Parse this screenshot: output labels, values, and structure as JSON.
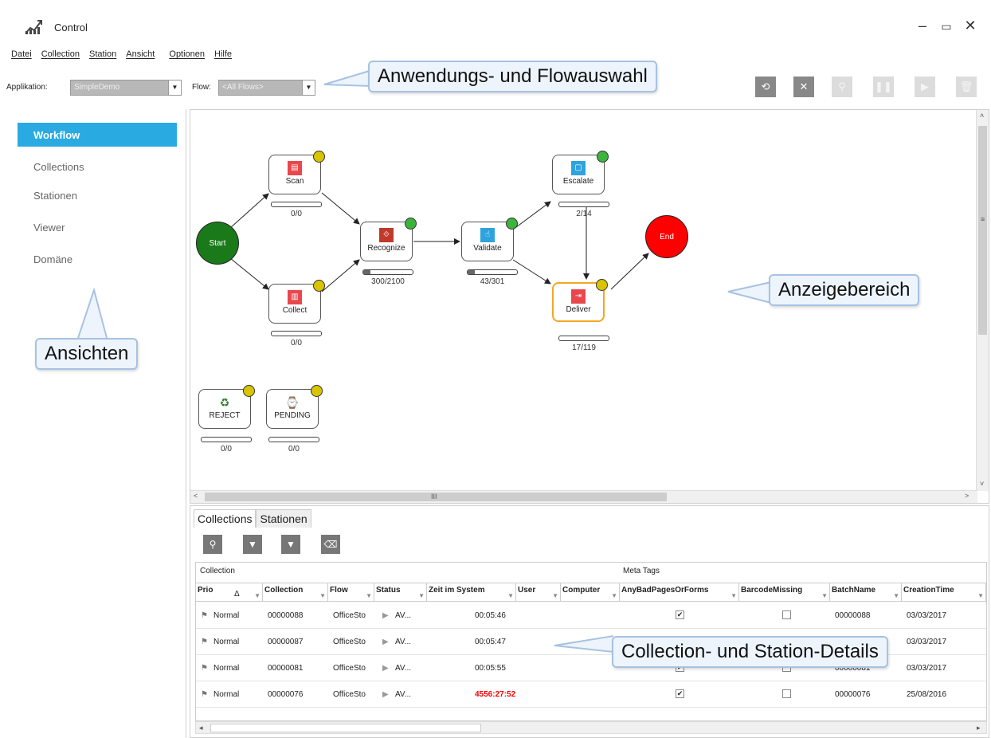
{
  "window": {
    "title": "Control",
    "minimize": "–",
    "maximize": "▭",
    "close": "✕"
  },
  "menu": [
    "Datei",
    "Collection",
    "Station",
    "Ansicht",
    "Optionen",
    "Hilfe"
  ],
  "selectors": {
    "app_label": "Applikation:",
    "app_value": "SimpleDemo",
    "flow_label": "Flow:",
    "flow_value": "<All Flows>"
  },
  "callouts": {
    "selection": "Anwendungs- und Flowauswahl",
    "views": "Ansichten",
    "display": "Anzeigebereich",
    "details": "Collection- und Station-Details"
  },
  "nav": [
    "Workflow",
    "Collections",
    "Stationen",
    "Viewer",
    "Domäne"
  ],
  "workflow": {
    "start": "Start",
    "end": "End",
    "nodes": {
      "scan": {
        "label": "Scan",
        "count": "0/0",
        "progress": 0,
        "status_color": "#d9c400"
      },
      "collect": {
        "label": "Collect",
        "count": "0/0",
        "progress": 0,
        "status_color": "#d9c400"
      },
      "recognize": {
        "label": "Recognize",
        "count": "300/2100",
        "progress": 0.14,
        "status_color": "#3cb43c"
      },
      "validate": {
        "label": "Validate",
        "count": "43/301",
        "progress": 0.14,
        "status_color": "#3cb43c"
      },
      "escalate": {
        "label": "Escalate",
        "count": "2/14",
        "progress": 0.0,
        "status_color": "#3cb43c"
      },
      "deliver": {
        "label": "Deliver",
        "count": "17/119",
        "progress": 0.0,
        "status_color": "#d9c400"
      },
      "reject": {
        "label": "REJECT",
        "count": "0/0",
        "progress": 0,
        "status_color": "#d9c400"
      },
      "pending": {
        "label": "PENDING",
        "count": "0/0",
        "progress": 0,
        "status_color": "#d9c400"
      }
    }
  },
  "details": {
    "tabs": [
      "Collections",
      "Stationen"
    ],
    "group_collection": "Collection",
    "group_meta": "Meta Tags",
    "columns": [
      "Prio",
      "Collection",
      "Flow",
      "Status",
      "Zeit im System",
      "User",
      "Computer",
      "AnyBadPagesOrForms",
      "BarcodeMissing",
      "BatchName",
      "CreationTime"
    ],
    "sort_indicator": "Δ",
    "rows": [
      {
        "prio": "Normal",
        "collection": "00000088",
        "flow": "OfficeSto",
        "status": "AV...",
        "time": "00:05:46",
        "time_alert": false,
        "bad": true,
        "barcode": false,
        "batch": "00000088",
        "created": "03/03/2017"
      },
      {
        "prio": "Normal",
        "collection": "00000087",
        "flow": "OfficeSto",
        "status": "AV...",
        "time": "00:05:47",
        "time_alert": false,
        "bad": true,
        "barcode": false,
        "batch": "00000087",
        "created": "03/03/2017"
      },
      {
        "prio": "Normal",
        "collection": "00000081",
        "flow": "OfficeSto",
        "status": "AV...",
        "time": "00:05:55",
        "time_alert": false,
        "bad": true,
        "barcode": false,
        "batch": "00000081",
        "created": "03/03/2017"
      },
      {
        "prio": "Normal",
        "collection": "00000076",
        "flow": "OfficeSto",
        "status": "AV...",
        "time": "4556:27:52",
        "time_alert": true,
        "bad": true,
        "barcode": false,
        "batch": "00000076",
        "created": "25/08/2016"
      }
    ]
  },
  "colors": {
    "accent": "#29abe2",
    "start": "#1a7a1a",
    "end": "#ff0000",
    "alert": "#ff0000",
    "highlight": "#f5a623"
  }
}
